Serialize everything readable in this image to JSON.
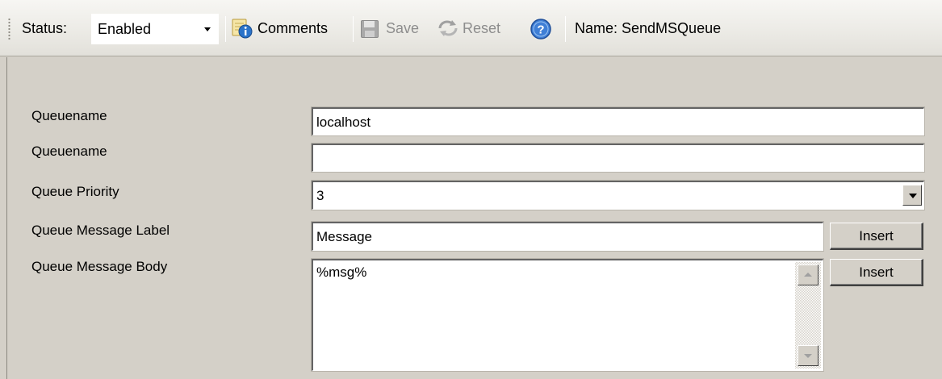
{
  "toolbar": {
    "status_label": "Status:",
    "status_value": "Enabled",
    "comments_label": "Comments",
    "save_label": "Save",
    "reset_label": "Reset",
    "name_text": "Name: SendMSQueue",
    "icons": {
      "comments": "comments-icon",
      "save": "save-icon",
      "reset": "reset-icon",
      "help": "help-icon"
    }
  },
  "form": {
    "fields": [
      {
        "label": "Queuename",
        "value": "localhost"
      },
      {
        "label": "Queuename",
        "value": ""
      },
      {
        "label": "Queue Priority",
        "value": "3"
      },
      {
        "label": "Queue Message Label",
        "value": "Message",
        "button": "Insert"
      },
      {
        "label": "Queue Message Body",
        "value": "%msg%",
        "button": "Insert"
      }
    ]
  },
  "colors": {
    "panel_bg": "#d4d0c8",
    "toolbar_bg": "#ecebe6",
    "disabled_text": "#8d8d8d"
  }
}
